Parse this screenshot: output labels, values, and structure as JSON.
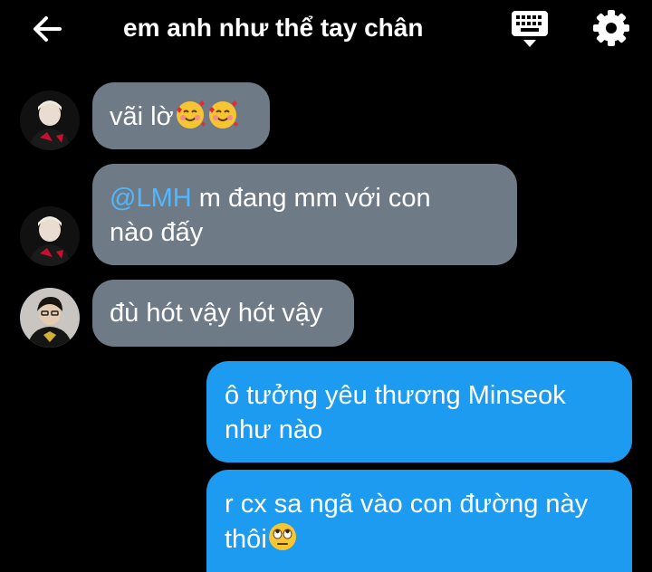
{
  "header": {
    "title": "em anh như thể tay chân",
    "back_icon": "arrow-left-icon",
    "keyboard_icon": "keyboard-icon",
    "settings_icon": "gear-icon"
  },
  "colors": {
    "background": "#000000",
    "incoming_bubble": "#6e7b87",
    "outgoing_bubble": "#1d9bf0",
    "mention": "#4fb8ff"
  },
  "messages": [
    {
      "direction": "incoming",
      "text": "vãi lờ",
      "emoji": [
        "smiling-face-with-hearts",
        "smiling-face-with-hearts"
      ]
    },
    {
      "direction": "incoming",
      "mention": "@LMH",
      "line1": " m đang mm với con",
      "line2": "nào đấy"
    },
    {
      "direction": "incoming",
      "text": "đù hót vậy hót vậy"
    },
    {
      "direction": "outgoing",
      "line1": "ô tưởng yêu thương Minseok",
      "line2": "như nào"
    },
    {
      "direction": "outgoing",
      "line1": "r cx sa ngã vào con đường này",
      "line2": "thôi",
      "emoji": [
        "face-with-rolling-eyes"
      ]
    }
  ]
}
